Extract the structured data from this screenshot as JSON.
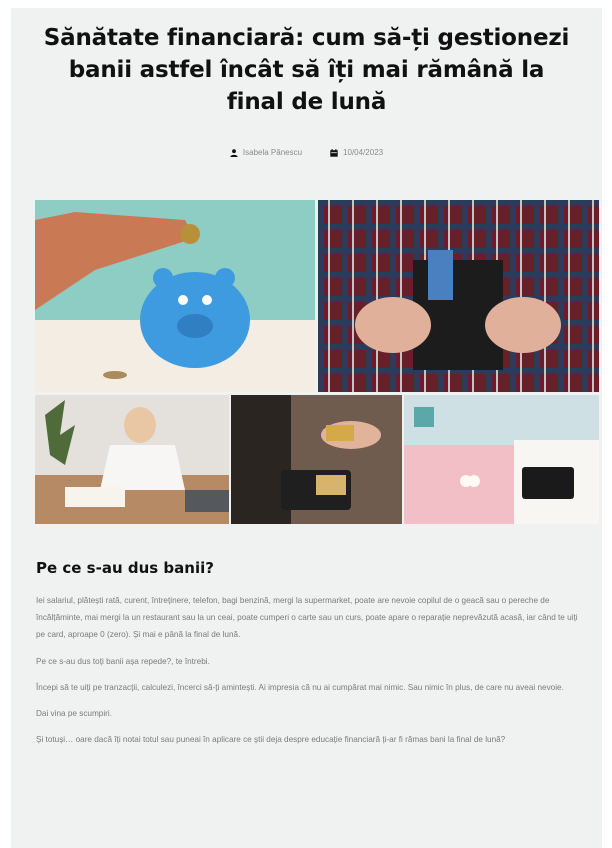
{
  "article": {
    "title": "Sănătate financiară: cum să-ți gestionezi banii astfel încât să îți mai rămână la final de lună",
    "author": "Isabela Pănescu",
    "date": "10/04/2023",
    "icons": {
      "author": "user-icon",
      "date": "calendar-icon"
    },
    "section_heading": "Pe ce s-au dus banii?",
    "paragraphs": [
      "Iei salariul, plătești rată, curent, întreținere, telefon, bagi benzină, mergi la supermarket, poate are nevoie copilul de o geacă sau o pereche de încălțăminte, mai mergi la un restaurant sau la un ceai, poate cumperi o carte sau un curs, poate apare o reparație neprevăzută acasă, iar când te uiți pe card, aproape 0 (zero). Și mai e până la final de lună.",
      "Pe ce s-au dus toți banii așa repede?, te întrebi.",
      "Începi să te uiți pe tranzacții, calculezi, încerci să-ți amintești. Ai impresia că nu ai cumpărat mai nimic. Sau nimic în plus, de care nu aveai nevoie.",
      "Dai vina pe scumpiri.",
      "Și totuși… oare dacă îți notai totul sau puneai în aplicare ce știi deja despre educație financiară ți-ar fi rămas bani la final de lună?"
    ]
  },
  "colors": {
    "page_bg": "#f0f2f1",
    "title": "#111111",
    "text": "#7a7a7a"
  }
}
